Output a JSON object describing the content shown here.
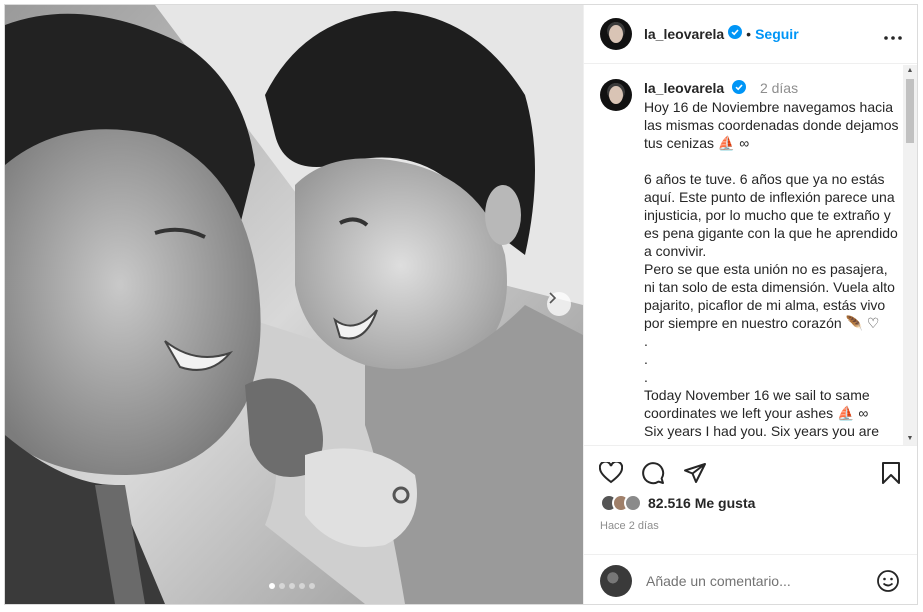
{
  "post": {
    "username": "la_leovarela",
    "separator": "•",
    "follow_label": "Seguir",
    "verified_icon": "verified-badge-icon",
    "more_icon": "more-options-icon"
  },
  "caption": {
    "username": "la_leovarela",
    "time_ago": "2 días",
    "text": "Hoy 16 de Noviembre navegamos hacia las mismas coordenadas donde dejamos tus cenizas ⛵ ∞\n\n6 años te tuve. 6 años que ya no estás aquí. Este punto de inflexión parece una injusticia, por lo mucho que te extraño y es pena gigante con la que he aprendido a convivir.\nPero se que esta unión no es pasajera, ni tan solo de esta dimensión. Vuela alto pajarito, picaflor de mi alma, estás vivo por siempre en nuestro corazón 🪶 ♡\n.\n.\n.\nToday November 16 we sail to same coordinates we left your ashes ⛵ ∞\nSix years I had you. Six years you are gone"
  },
  "actions": {
    "like_icon": "heart-icon",
    "comment_icon": "comment-icon",
    "share_icon": "share-icon",
    "save_icon": "bookmark-icon",
    "likes_text": "82.516 Me gusta",
    "posted_ago": "Hace 2 días"
  },
  "comment": {
    "placeholder": "Añade un comentario...",
    "emoji_icon": "emoji-icon"
  },
  "carousel": {
    "next_icon": "chevron-right-icon",
    "slide_count": 5,
    "active_slide": 1
  },
  "colors": {
    "accent": "#0095f6",
    "verified": "#0095f6",
    "text": "#262626",
    "muted": "#8e8e8e"
  }
}
